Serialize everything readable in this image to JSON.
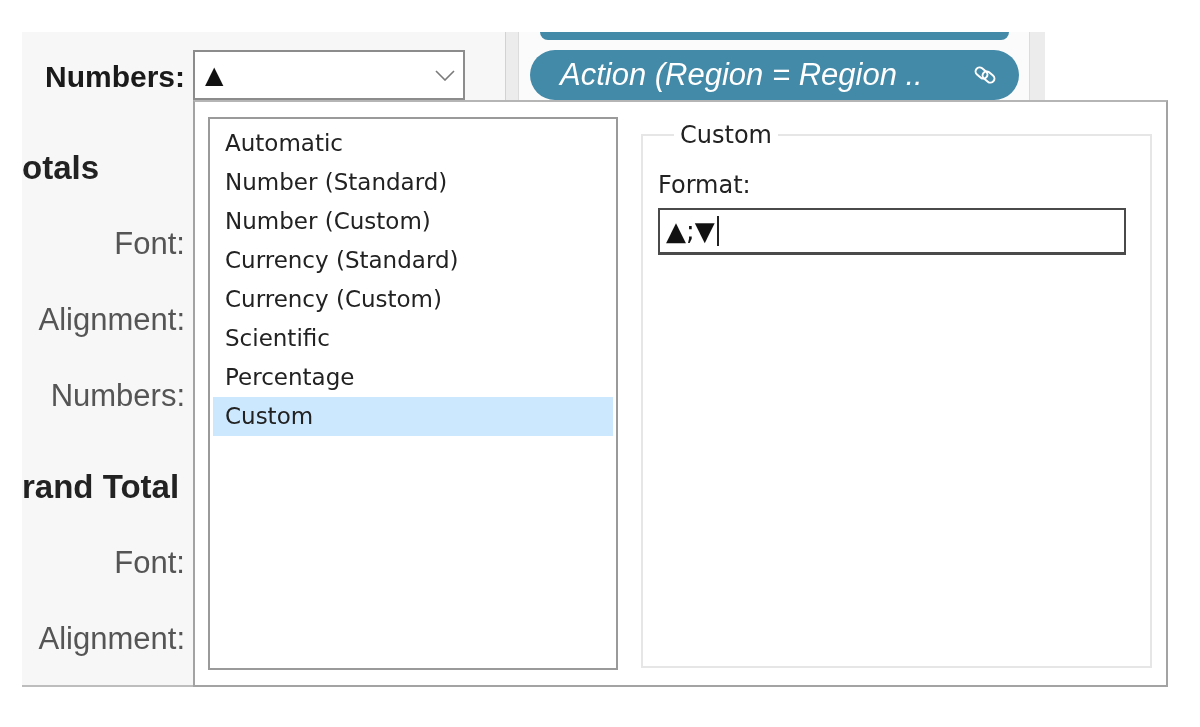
{
  "format_pane": {
    "numbers_label": "Numbers:",
    "numbers_dropdown": {
      "value": "▲",
      "expanded": true
    },
    "sections": [
      {
        "heading": "otals",
        "labels": [
          "Font:",
          "Alignment:",
          "Numbers:"
        ]
      },
      {
        "heading": "rand Total",
        "labels": [
          "Font:",
          "Alignment:"
        ]
      }
    ]
  },
  "marks_shelf": {
    "pills": [
      {
        "label": "Action (Region = Region .."
      }
    ]
  },
  "number_format_popup": {
    "options": [
      {
        "label": "Automatic",
        "selected": false
      },
      {
        "label": "Number (Standard)",
        "selected": false
      },
      {
        "label": "Number (Custom)",
        "selected": false
      },
      {
        "label": "Currency (Standard)",
        "selected": false
      },
      {
        "label": "Currency (Custom)",
        "selected": false
      },
      {
        "label": "Scientific",
        "selected": false
      },
      {
        "label": "Percentage",
        "selected": false
      },
      {
        "label": "Custom",
        "selected": true
      }
    ],
    "custom_group": {
      "legend": "Custom",
      "format_label": "Format:",
      "format_value": "▲;▼"
    }
  }
}
